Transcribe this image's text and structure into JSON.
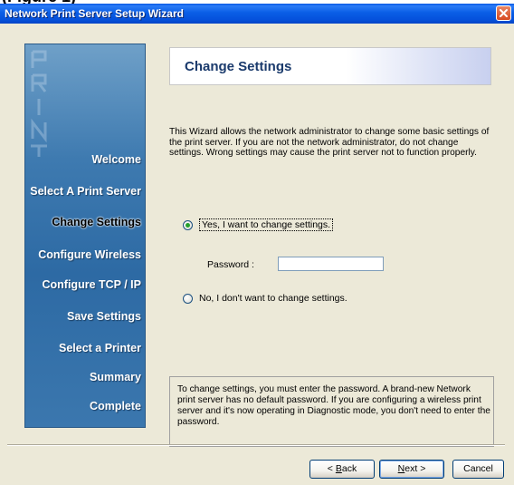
{
  "window": {
    "title": "Network Print Server Setup Wizard"
  },
  "sidebar": {
    "deco_text": "PRINT",
    "items": [
      {
        "label": "Welcome"
      },
      {
        "label": "Select A Print Server"
      },
      {
        "label": "Change Settings",
        "active": true
      },
      {
        "label": "Configure Wireless"
      },
      {
        "label": "Configure TCP / IP"
      },
      {
        "label": "Save Settings"
      },
      {
        "label": "Select a Printer"
      },
      {
        "label": "Summary"
      },
      {
        "label": "Complete"
      }
    ]
  },
  "header": {
    "title": "Change Settings"
  },
  "intro": {
    "text": "This Wizard allows the network administrator to change some basic settings of the print server. If you are not the network administrator, do not change settings. Wrong settings may cause the print server not to function properly."
  },
  "options": {
    "yes_label": "Yes, I want to change settings.",
    "yes_selected": true,
    "password_label": "Password :",
    "password_value": "",
    "no_label": "No, I don't want to change settings.",
    "no_selected": false
  },
  "info": {
    "text": "To change settings, you must enter the password. A brand-new Network print server has no default password. If you are configuring a wireless print server and it's now operating in Diagnostic mode, you don't need to enter the password."
  },
  "buttons": {
    "back_prefix": "< ",
    "back_mnemonic": "B",
    "back_rest": "ack",
    "next_mnemonic": "N",
    "next_rest": "ext >",
    "cancel": "Cancel"
  },
  "colors": {
    "titlebar": "#0a5ee6",
    "sidebar": "#3e7ab0",
    "header_title": "#1a3a6c",
    "radio_dot": "#24a02c"
  },
  "icons": {
    "close": "close-icon"
  }
}
